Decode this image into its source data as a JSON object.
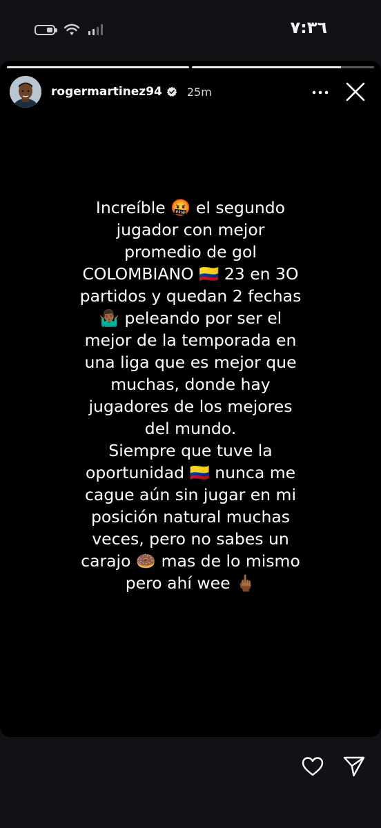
{
  "status_bar": {
    "time": "٧:٣٦",
    "battery_level": 0.4,
    "icons": [
      "battery-icon",
      "wifi-icon",
      "signal-icon"
    ]
  },
  "story": {
    "progress": [
      1.0,
      0.82
    ],
    "username": "rogermartinez94",
    "verified": true,
    "timestamp": "25m",
    "caption_lines": [
      "Increíble 🤬 el segundo",
      "jugador con mejor",
      "promedio de gol",
      "COLOMBIANO 🇨🇴 23 en 3O",
      "partidos y quedan 2 fechas",
      "🤷🏾‍♂️ peleando por ser el",
      "mejor de la temporada en",
      "una liga que es mejor que",
      "muchas, donde hay",
      "jugadores de los mejores",
      "del mundo.",
      "Siempre que tuve la",
      "oportunidad 🇨🇴  nunca me",
      "cague aún sin jugar en mi",
      "posición natural muchas",
      "veces, pero no sabes un",
      "carajo  🍩  mas de lo mismo",
      "pero ahí wee 🖕🏾"
    ]
  },
  "actions": {
    "like": "heart-icon",
    "share": "send-icon",
    "more": "more-dots-icon",
    "close": "close-icon"
  },
  "colors": {
    "background": "#101216",
    "story_background": "#000000",
    "text": "#ffffff"
  }
}
